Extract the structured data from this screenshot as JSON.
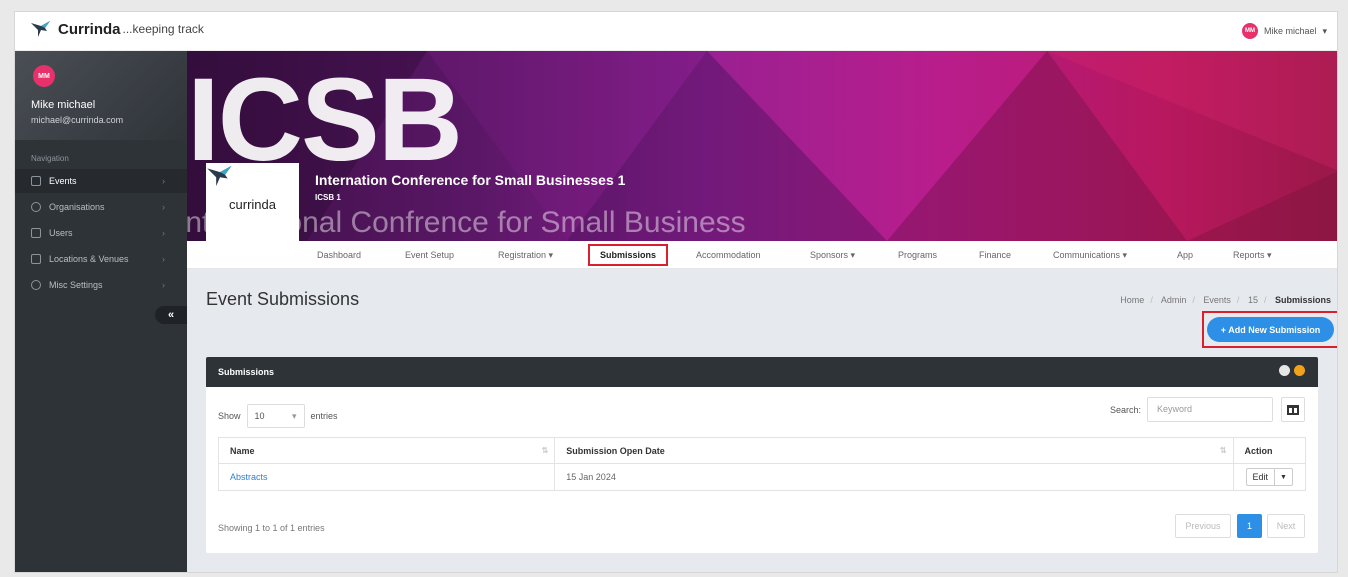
{
  "app": {
    "brand": "Currinda",
    "tagline": "...keeping track"
  },
  "user": {
    "initials": "MM",
    "name": "Mike michael",
    "email": "michael@currinda.com",
    "menu_label": "Mike michael"
  },
  "sidebar": {
    "nav_title": "Navigation",
    "items": [
      {
        "label": "Events",
        "icon": "calendar-icon",
        "active": true
      },
      {
        "label": "Organisations",
        "icon": "globe-icon"
      },
      {
        "label": "Users",
        "icon": "users-icon"
      },
      {
        "label": "Locations & Venues",
        "icon": "map-icon"
      },
      {
        "label": "Misc Settings",
        "icon": "gear-icon"
      }
    ],
    "collapse_label": "«"
  },
  "event": {
    "acronym_bg": "ICSB",
    "name_bg": "International Confrence for Small Business",
    "title": "Internation Conference for Small Businesses 1",
    "code": "ICSB 1",
    "logo_text": "currinda"
  },
  "tabs": [
    {
      "label": "Dashboard"
    },
    {
      "label": "Event Setup"
    },
    {
      "label": "Registration",
      "caret": true
    },
    {
      "label": "Submissions",
      "active": true
    },
    {
      "label": "Accommodation"
    },
    {
      "label": "Sponsors",
      "caret": true
    },
    {
      "label": "Programs"
    },
    {
      "label": "Finance"
    },
    {
      "label": "Communications",
      "caret": true
    },
    {
      "label": "App"
    },
    {
      "label": "Reports",
      "caret": true
    }
  ],
  "page": {
    "title": "Event Submissions",
    "breadcrumb": [
      "Home",
      "Admin",
      "Events",
      "15",
      "Submissions"
    ],
    "add_button": "+ Add New Submission"
  },
  "panel": {
    "title": "Submissions",
    "show_label": "Show",
    "entries_value": "10",
    "entries_label": "entries",
    "search_label": "Search:",
    "search_placeholder": "Keyword",
    "columns": [
      "Name",
      "Submission Open Date",
      "Action"
    ],
    "rows": [
      {
        "name": "Abstracts",
        "open_date": "15 Jan 2024",
        "action": "Edit"
      }
    ],
    "info": "Showing 1 to 1 of 1 entries",
    "pagination": {
      "previous": "Previous",
      "current": "1",
      "next": "Next"
    }
  },
  "colors": {
    "accent": "#2d8fe6",
    "highlight": "#d9202e",
    "sidebar": "#2e3338",
    "avatar": "#e8306a"
  }
}
